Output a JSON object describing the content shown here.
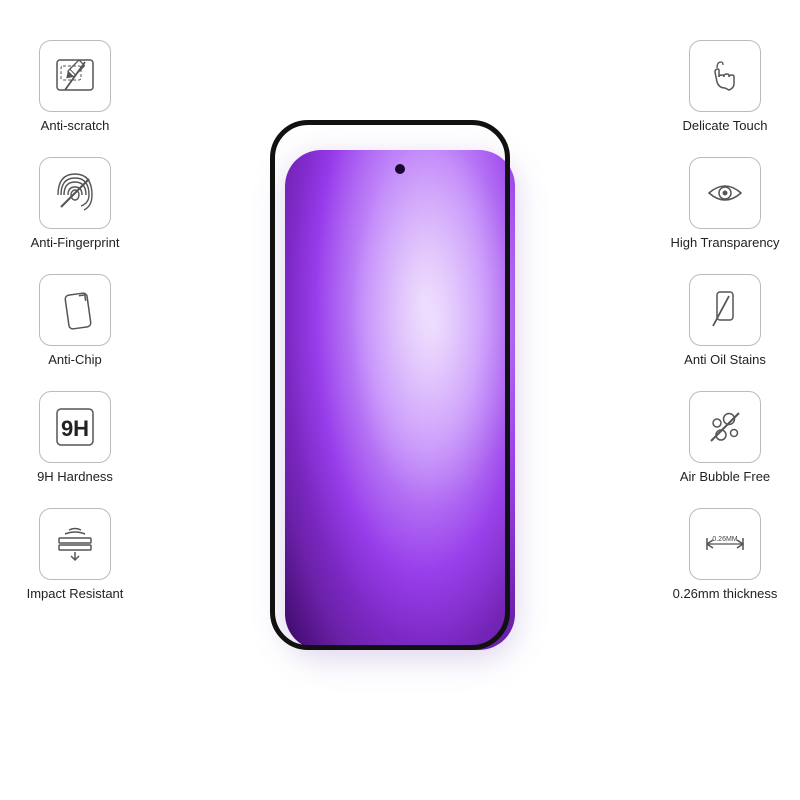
{
  "features_left": [
    {
      "id": "anti-scratch",
      "label": "Anti-scratch"
    },
    {
      "id": "anti-fingerprint",
      "label": "Anti-Fingerprint"
    },
    {
      "id": "anti-chip",
      "label": "Anti-Chip"
    },
    {
      "id": "9h-hardness",
      "label": "9H Hardness"
    },
    {
      "id": "impact-resistant",
      "label": "Impact Resistant"
    }
  ],
  "features_right": [
    {
      "id": "delicate-touch",
      "label": "Delicate Touch"
    },
    {
      "id": "high-transparency",
      "label": "High Transparency"
    },
    {
      "id": "anti-oil-stains",
      "label": "Anti Oil Stains"
    },
    {
      "id": "air-bubble-free",
      "label": "Air Bubble Free"
    },
    {
      "id": "thickness",
      "label": "0.26mm thickness"
    }
  ]
}
